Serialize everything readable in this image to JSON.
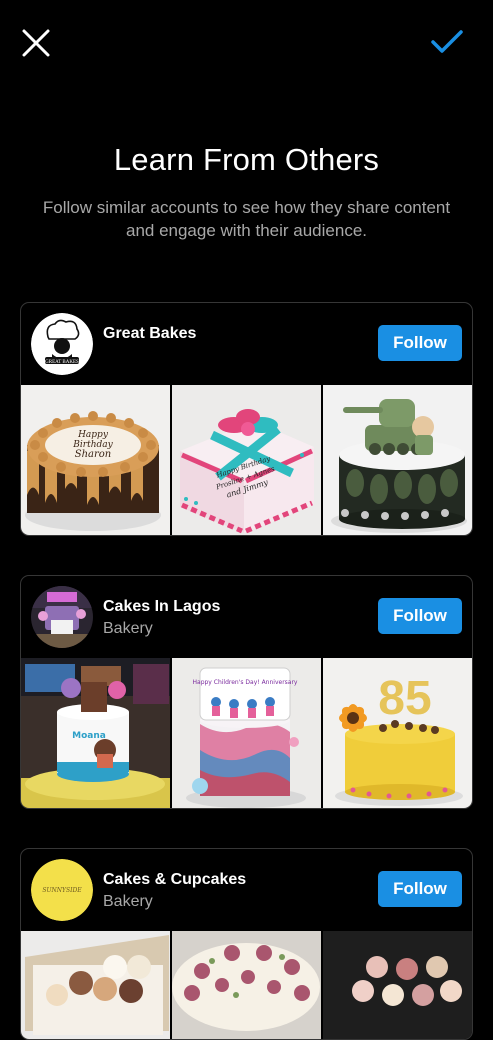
{
  "header": {
    "close_icon": "close-icon",
    "done_icon": "checkmark-icon",
    "accent_color": "#1a8fe3"
  },
  "intro": {
    "title": "Learn From Others",
    "subtitle": "Follow similar accounts to see how they share content and engage with their audience."
  },
  "accounts": [
    {
      "name": "Great Bakes",
      "category": "",
      "follow_label": "Follow",
      "avatar_text": "GREAT BAKES",
      "thumbs": [
        {
          "cake_text_1": "Happy",
          "cake_text_2": "Birthday",
          "cake_text_3": "Sharon"
        },
        {
          "cake_text_1": "Happy Birthday",
          "cake_text_2": "Prosline + Agnes",
          "cake_text_3": "and Jimmy"
        },
        {
          "cake_text_1": ""
        }
      ]
    },
    {
      "name": "Cakes In Lagos",
      "category": "Bakery",
      "follow_label": "Follow",
      "thumbs": [
        {
          "cake_text_1": "Moana"
        },
        {
          "cake_text_1": "Happy Children's Day! Anniversary"
        },
        {
          "cake_text_1": "85"
        }
      ]
    },
    {
      "name": "Cakes & Cupcakes",
      "category": "Bakery",
      "follow_label": "Follow",
      "avatar_text": "SUNNYSIDE"
    }
  ]
}
